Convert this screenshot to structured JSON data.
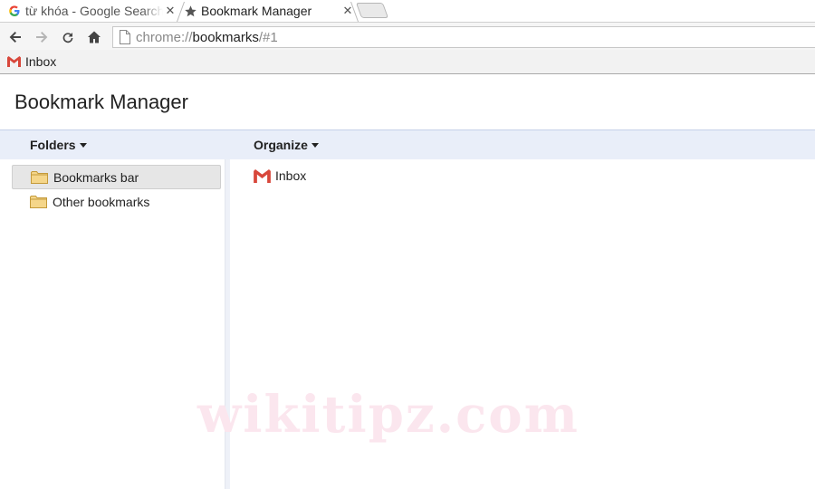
{
  "tabs": [
    {
      "title": "từ khóa - Google Search",
      "favicon": "google-g-icon"
    },
    {
      "title": "Bookmark Manager",
      "favicon": "star-icon"
    }
  ],
  "toolbar": {
    "url_scheme": "chrome://",
    "url_host": "bookmarks",
    "url_path": "/#1"
  },
  "bookmarks_bar": {
    "items": [
      {
        "label": "Inbox",
        "icon": "gmail-icon"
      }
    ]
  },
  "page": {
    "title": "Bookmark Manager",
    "folders_label": "Folders",
    "organize_label": "Organize"
  },
  "tree": {
    "items": [
      {
        "label": "Bookmarks bar",
        "selected": true
      },
      {
        "label": "Other bookmarks",
        "selected": false
      }
    ]
  },
  "list": {
    "items": [
      {
        "label": "Inbox",
        "icon": "gmail-icon"
      }
    ]
  },
  "watermark": "wikitipz.com",
  "colors": {
    "header_bg": "#e9eef9",
    "folder_fill": "#f5d68a",
    "gmail_red": "#d8473b"
  }
}
